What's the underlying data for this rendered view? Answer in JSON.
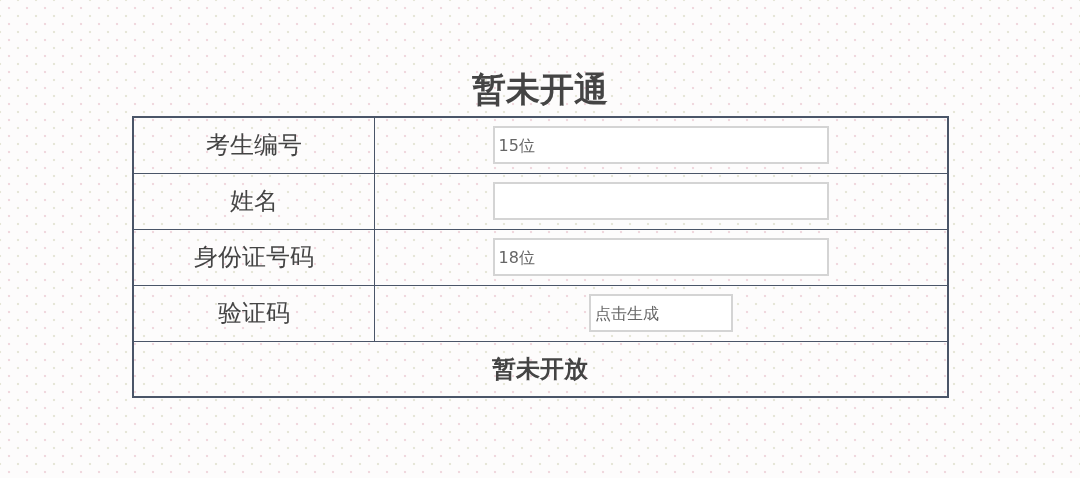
{
  "title": "暂未开通",
  "fields": [
    {
      "label": "考生编号",
      "placeholder": "15位",
      "kind": "wide"
    },
    {
      "label": "姓名",
      "kind": "wide"
    },
    {
      "label": "身份证号码",
      "placeholder": "18位",
      "kind": "wide"
    },
    {
      "label": "验证码",
      "placeholder": "点击生成",
      "kind": "short"
    }
  ],
  "footer": "暂未开放"
}
